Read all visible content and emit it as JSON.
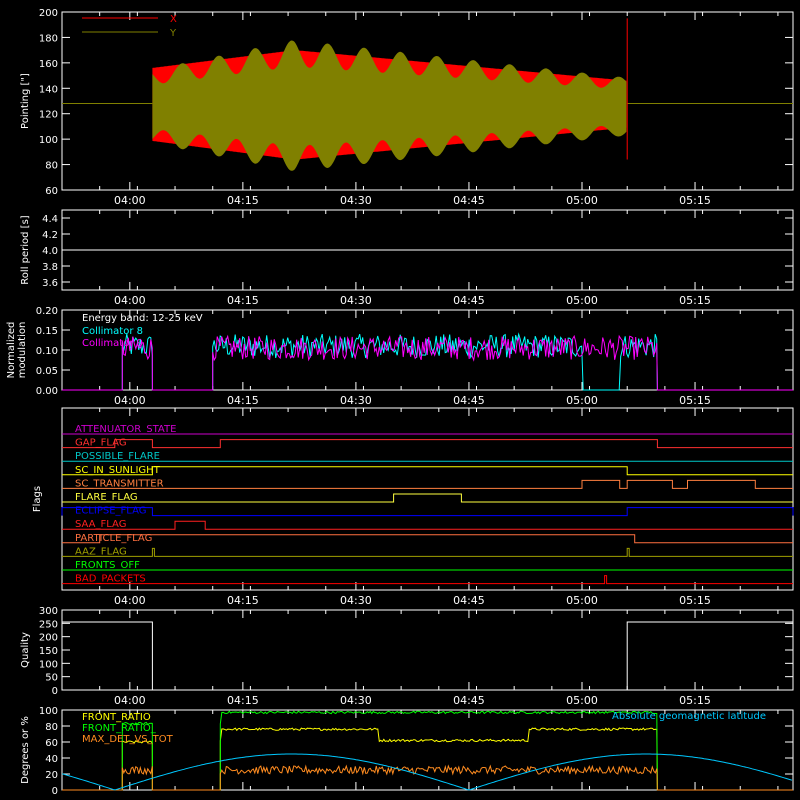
{
  "time_ticks": [
    "04:00",
    "04:15",
    "04:30",
    "04:45",
    "05:00",
    "05:15"
  ],
  "chart_data": [
    {
      "type": "line",
      "id": "pointing",
      "ylabel": "Pointing [\"]",
      "ylim": [
        60,
        200
      ],
      "yticks": [
        60,
        80,
        100,
        120,
        140,
        160,
        180,
        200
      ],
      "series": [
        {
          "name": "X",
          "color": "#ff0000",
          "center": 128,
          "amplitude_start": 28,
          "amplitude_peak": 42,
          "amplitude_end": 18
        },
        {
          "name": "Y",
          "color": "#808000",
          "center": 125,
          "amplitude_start": 28,
          "amplitude_peak": 50,
          "amplitude_end": 22
        }
      ],
      "baseline": 128,
      "active_range": [
        "03:59",
        "05:06"
      ]
    },
    {
      "type": "line",
      "id": "roll",
      "ylabel": "Roll period [s]",
      "ylim": [
        3.5,
        4.5
      ],
      "yticks": [
        "3.6",
        "3.8",
        "4.0",
        "4.2",
        "4.4"
      ],
      "series": [
        {
          "name": "",
          "color": "#ffffff",
          "value": 4.0
        }
      ]
    },
    {
      "type": "line",
      "id": "modulation",
      "ylabel": "Normalized modulation",
      "ylim": [
        0,
        0.2
      ],
      "yticks": [
        "0.00",
        "0.05",
        "0.10",
        "0.15",
        "0.20"
      ],
      "annotations": [
        "Energy band: 12-25 keV"
      ],
      "series": [
        {
          "name": "Collimator 8",
          "color": "#00ffff",
          "level": 0.11
        },
        {
          "name": "Collimator 9",
          "color": "#ff00ff",
          "level": 0.105
        }
      ],
      "segments": [
        [
          "03:59",
          "04:03"
        ],
        [
          "04:11",
          "05:10"
        ]
      ],
      "cyan_gaps": [
        "05:00",
        "05:05"
      ]
    },
    {
      "type": "line",
      "id": "flags",
      "ylabel": "Flags",
      "flags": [
        {
          "name": "ATTENUATOR_STATE",
          "color": "#cc00cc",
          "on": []
        },
        {
          "name": "GAP_FLAG",
          "color": "#ff3030",
          "on": [
            [
              "03:58",
              "04:03"
            ],
            [
              "04:12",
              "05:10"
            ]
          ]
        },
        {
          "name": "POSSIBLE_FLARE",
          "color": "#00c8c8",
          "on": []
        },
        {
          "name": "SC_IN_SUNLIGHT",
          "color": "#ffff00",
          "on": [
            [
              "04:03",
              "05:06"
            ]
          ]
        },
        {
          "name": "SC_TRANSMITTER",
          "color": "#ff8040",
          "on": [
            [
              "05:00",
              "05:05"
            ],
            [
              "05:06",
              "05:12"
            ],
            [
              "05:14",
              "05:23"
            ]
          ]
        },
        {
          "name": "FLARE_FLAG",
          "color": "#ffff40",
          "on": [
            [
              "04:35",
              "04:44"
            ]
          ]
        },
        {
          "name": "ECLIPSE_FLAG",
          "color": "#0000ff",
          "on": [
            [
              "03:51",
              "04:03"
            ],
            [
              "05:06",
              "05:28"
            ]
          ]
        },
        {
          "name": "SAA_FLAG",
          "color": "#ff2020",
          "on": [
            [
              "04:06",
              "04:10"
            ]
          ]
        },
        {
          "name": "PARTICLE_FLAG",
          "color": "#ff7040",
          "on": [
            [
              "03:56",
              "05:07"
            ]
          ]
        },
        {
          "name": "AAZ_FLAG",
          "color": "#a0a000",
          "on": [
            [
              "04:03",
              "04:03"
            ],
            [
              "05:06",
              "05:06"
            ]
          ]
        },
        {
          "name": "FRONTS_OFF",
          "color": "#00ff00",
          "on": []
        },
        {
          "name": "BAD_PACKETS",
          "color": "#ff0000",
          "on": [
            [
              "05:03",
              "05:03"
            ]
          ]
        }
      ]
    },
    {
      "type": "line",
      "id": "quality",
      "ylabel": "Quality",
      "ylim": [
        0,
        300
      ],
      "yticks": [
        0,
        50,
        100,
        150,
        200,
        250,
        300
      ],
      "series": [
        {
          "name": "",
          "color": "#ffffff",
          "high": 255,
          "low": 0,
          "steps": [
            [
              "03:51",
              "04:03",
              255
            ],
            [
              "04:03",
              "05:06",
              0
            ],
            [
              "05:06",
              "05:28",
              255
            ]
          ]
        }
      ]
    },
    {
      "type": "line",
      "id": "ratios",
      "ylabel": "Degrees or %",
      "ylim": [
        0,
        100
      ],
      "yticks": [
        0,
        20,
        40,
        60,
        80,
        100
      ],
      "series": [
        {
          "name": "FRONT_RATIO",
          "color": "#ffff00",
          "level": 60
        },
        {
          "name": "FRONT_RATIO_",
          "color": "#00ff00",
          "level": 83
        },
        {
          "name": "MAX_DET_VS_TOT",
          "color": "#ff8c20",
          "level": 25
        },
        {
          "name": "Absolute geomagnetic latitude",
          "color": "#00c8ff"
        }
      ]
    }
  ]
}
